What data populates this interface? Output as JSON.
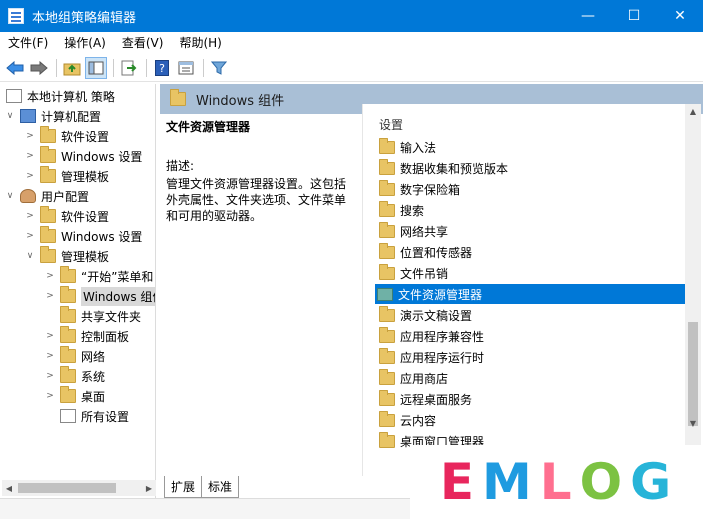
{
  "window": {
    "title": "本地组策略编辑器",
    "minimize": "—",
    "maximize": "☐",
    "close": "✕"
  },
  "menu": [
    "文件(F)",
    "操作(A)",
    "查看(V)",
    "帮助(H)"
  ],
  "toolbar": {
    "back": "back-arrow",
    "forward": "forward-arrow",
    "help": "?"
  },
  "tree": [
    {
      "label": "本地计算机 策略",
      "icon": "doc-icon",
      "expander": "",
      "level": 0
    },
    {
      "label": "计算机配置",
      "icon": "pc-icon",
      "expander": "∨",
      "level": 1
    },
    {
      "label": "软件设置",
      "icon": "folder-icon",
      "expander": ">",
      "level": 2
    },
    {
      "label": "Windows 设置",
      "icon": "folder-icon",
      "expander": ">",
      "level": 2
    },
    {
      "label": "管理模板",
      "icon": "folder-icon",
      "expander": ">",
      "level": 2
    },
    {
      "label": "用户配置",
      "icon": "user-icon",
      "expander": "∨",
      "level": 1
    },
    {
      "label": "软件设置",
      "icon": "folder-icon",
      "expander": ">",
      "level": 2
    },
    {
      "label": "Windows 设置",
      "icon": "folder-icon",
      "expander": ">",
      "level": 2
    },
    {
      "label": "管理模板",
      "icon": "folder-icon",
      "expander": "∨",
      "level": 2
    },
    {
      "label": "“开始”菜单和",
      "icon": "folder-icon",
      "expander": ">",
      "level": 3
    },
    {
      "label": "Windows 组件",
      "icon": "folder-icon",
      "expander": ">",
      "level": 3,
      "selected": true
    },
    {
      "label": "共享文件夹",
      "icon": "folder-icon",
      "expander": "",
      "level": 3
    },
    {
      "label": "控制面板",
      "icon": "folder-icon",
      "expander": ">",
      "level": 3
    },
    {
      "label": "网络",
      "icon": "folder-icon",
      "expander": ">",
      "level": 3
    },
    {
      "label": "系统",
      "icon": "folder-icon",
      "expander": ">",
      "level": 3
    },
    {
      "label": "桌面",
      "icon": "folder-icon",
      "expander": ">",
      "level": 3
    },
    {
      "label": "所有设置",
      "icon": "doc-icon",
      "expander": "",
      "level": 3
    }
  ],
  "right_header": "Windows 组件",
  "description": {
    "title": "文件资源管理器",
    "label": "描述:",
    "text": "管理文件资源管理器设置。这包括外壳属性、文件夹选项、文件菜单和可用的驱动器。"
  },
  "settings": {
    "column_header": "设置",
    "items": [
      "输入法",
      "数据收集和预览版本",
      "数字保险箱",
      "搜索",
      "网络共享",
      "位置和传感器",
      "文件吊销",
      "文件资源管理器",
      "演示文稿设置",
      "应用程序兼容性",
      "应用程序运行时",
      "应用商店",
      "远程桌面服务",
      "云内容",
      "桌面窗口管理器"
    ],
    "selected_index": 7
  },
  "tabs": [
    "扩展",
    "标准"
  ],
  "watermark": {
    "letters": [
      "E",
      "M",
      "L",
      "O",
      "G"
    ],
    "colors": [
      "#e8265d",
      "#1f9be0",
      "#ff6f8f",
      "#7cc242",
      "#27b4d8"
    ]
  }
}
